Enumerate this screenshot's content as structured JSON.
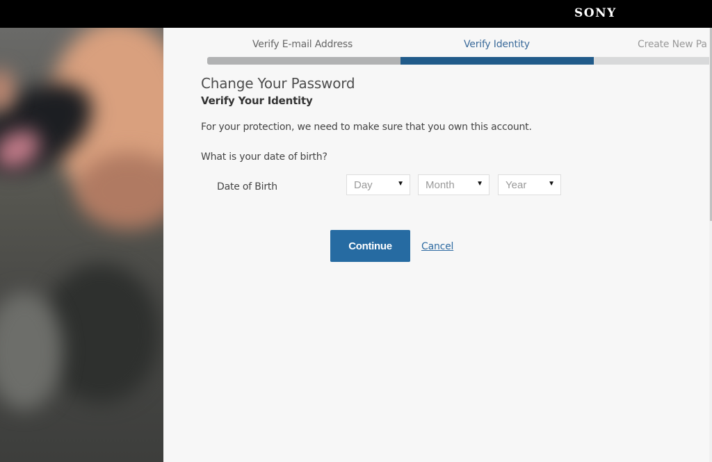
{
  "header": {
    "brand": "SONY",
    "background_color": "#000000"
  },
  "hero_image": {
    "description": "Blurred photo of hands holding a phone"
  },
  "progress": {
    "steps": [
      {
        "label": "Verify E-mail Address",
        "state": "done"
      },
      {
        "label": "Verify Identity",
        "state": "active"
      },
      {
        "label": "Create New Pa",
        "state": "upcoming"
      }
    ],
    "colors": {
      "done": "#b1b2b3",
      "active": "#215b8a",
      "upcoming": "#d8d9da"
    }
  },
  "form": {
    "title": "Change Your Password",
    "subtitle": "Verify Your Identity",
    "description": "For your protection, we need to make sure that you own this account.",
    "question": "What is your date of birth?",
    "dob_label": "Date of Birth",
    "selects": [
      {
        "name": "day",
        "value": "Day",
        "caret": "▼"
      },
      {
        "name": "month",
        "value": "Month",
        "caret": "▼"
      },
      {
        "name": "year",
        "value": "Year",
        "caret": "▼"
      }
    ],
    "continue_label": "Continue",
    "cancel_label": "Cancel",
    "accent_color": "#266ba2"
  }
}
